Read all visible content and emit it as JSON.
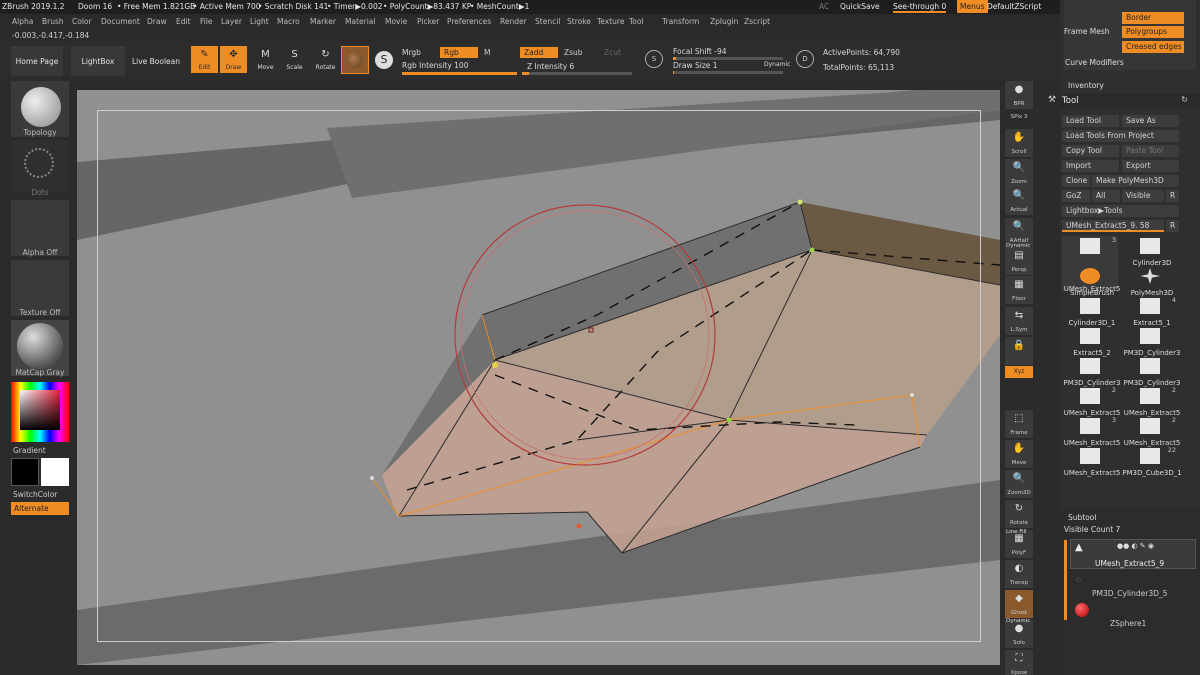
{
  "titlebar": {
    "app": "ZBrush 2019.1.2",
    "doc": "Doom 16",
    "free_mem": "• Free Mem 1.821GB",
    "active_mem": "• Active Mem 700",
    "scratch": "• Scratch Disk 141",
    "timer": "• Timer▶0.002",
    "polycount": "• PolyCount▶83.437 KP",
    "meshcount": "• MeshCount▶1",
    "ac": "AC",
    "quicksave": "QuickSave",
    "see_through": "See-through  0",
    "menus": "Menus",
    "script": "DefaultZScript"
  },
  "menubar": [
    "Alpha",
    "Brush",
    "Color",
    "Document",
    "Draw",
    "Edit",
    "File",
    "Layer",
    "Light",
    "Macro",
    "Marker",
    "Material",
    "Movie",
    "Picker",
    "Preferences",
    "Render",
    "Stencil",
    "Stroke",
    "Texture",
    "Tool",
    "Transform",
    "Zplugin",
    "Zscript"
  ],
  "coords": "-0.003,-0.417,-0.184",
  "shelf": {
    "home_page": "Home Page",
    "lightbox": "LightBox",
    "live_boolean": "Live Boolean",
    "tools": [
      {
        "label": "Edit",
        "icon": "✎",
        "active": true
      },
      {
        "label": "Draw",
        "icon": "✥",
        "active": true
      },
      {
        "label": "Move",
        "icon": "M",
        "active": false
      },
      {
        "label": "Scale",
        "icon": "S",
        "active": false
      },
      {
        "label": "Rotate",
        "icon": "↻",
        "active": false
      }
    ],
    "mrgb": "Mrgb",
    "rgb": "Rgb",
    "m": "M",
    "zadd": "Zadd",
    "zsub": "Zsub",
    "zcut": "Zcut",
    "rgb_intensity": "Rgb Intensity 100",
    "z_intensity": "Z Intensity 6",
    "focal_shift": "Focal Shift -94",
    "draw_size": "Draw Size 1",
    "dynamic": "Dynamic",
    "active_points": "ActivePoints: 64,790",
    "total_points": "TotalPoints: 65,113"
  },
  "left_tray": {
    "topology": "Topology",
    "dots": "Dots",
    "alpha_off": "Alpha Off",
    "texture_off": "Texture Off",
    "matcap": "MatCap Gray",
    "gradient": "Gradient",
    "switch_color": "SwitchColor",
    "alternate": "Alternate"
  },
  "right_strip": [
    {
      "label": "BPR",
      "icon": "●"
    },
    {
      "label": "SPix 3",
      "icon": ""
    },
    {
      "label": "Scroll",
      "icon": "✋"
    },
    {
      "label": "Zoom",
      "icon": "🔍"
    },
    {
      "label": "Actual",
      "icon": "🔍"
    },
    {
      "label": "AAHalf",
      "icon": "🔍"
    },
    {
      "label": "Persp",
      "icon": "▤"
    },
    {
      "label": "Floor",
      "icon": "▦"
    },
    {
      "label": "L.Sym",
      "icon": "⇆"
    },
    {
      "label": "",
      "icon": "🔒"
    },
    {
      "label": "Frame",
      "icon": "⬚"
    },
    {
      "label": "Move",
      "icon": "✋"
    },
    {
      "label": "Zoom3D",
      "icon": "🔍"
    },
    {
      "label": "Rotate",
      "icon": "↻"
    },
    {
      "label": "PolyF",
      "icon": "▦"
    },
    {
      "label": "Transp",
      "icon": "◐"
    },
    {
      "label": "Ghost",
      "icon": "◆"
    },
    {
      "label": "Solo",
      "icon": "●"
    },
    {
      "label": "Xpose",
      "icon": "⛶"
    }
  ],
  "right_strip_misc": {
    "dynamic": "Dynamic",
    "line_fill": "Line Fill",
    "xyz": "Xyz"
  },
  "right_panel": {
    "frame_mesh": "Frame Mesh",
    "border": "Border",
    "polygroups": "Polygroups",
    "creased_edges": "Creased edges",
    "curve_modifiers": "Curve Modifiers",
    "inventory": "Inventory",
    "tool": "Tool",
    "load_tool": "Load Tool",
    "save_as": "Save As",
    "load_from_project": "Load Tools From Project",
    "copy_tool": "Copy Tool",
    "paste_tool": "Paste Tool",
    "import": "Import",
    "export": "Export",
    "clone": "Clone",
    "make_polymesh": "Make PolyMesh3D",
    "goz": "GoZ",
    "all": "All",
    "visible": "Visible",
    "r": "R",
    "lightbox_tools": "Lightbox▶Tools",
    "current_tool": "UMesh_Extract5_9. 58",
    "thumbs": [
      {
        "name": "UMesh_Extract5",
        "count": "3"
      },
      {
        "name": "Cylinder3D",
        "count": ""
      },
      {
        "name": "SimpleBrush",
        "count": ""
      },
      {
        "name": "PolyMesh3D",
        "count": ""
      },
      {
        "name": "Cylinder3D_1",
        "count": ""
      },
      {
        "name": "Extract5_1",
        "count": "4"
      },
      {
        "name": "Extract5_2",
        "count": ""
      },
      {
        "name": "PM3D_Cylinder3",
        "count": ""
      },
      {
        "name": "PM3D_Cylinder3",
        "count": ""
      },
      {
        "name": "PM3D_Cylinder3",
        "count": ""
      },
      {
        "name": "UMesh_Extract5",
        "count": "2"
      },
      {
        "name": "UMesh_Extract5",
        "count": "2"
      },
      {
        "name": "UMesh_Extract5",
        "count": "3"
      },
      {
        "name": "UMesh_Extract5",
        "count": "2"
      },
      {
        "name": "UMesh_Extract5",
        "count": ""
      },
      {
        "name": "PM3D_Cube3D_1",
        "count": "22"
      }
    ],
    "subtool": "Subtool",
    "visible_count": "Visible Count 7",
    "subtools": [
      "UMesh_Extract5_9",
      "PM3D_Cylinder3D_5",
      "ZSphere1"
    ]
  },
  "colors": {
    "accent": "#ef8d24",
    "panel": "#2f2f2f",
    "viewport": "#909090"
  }
}
